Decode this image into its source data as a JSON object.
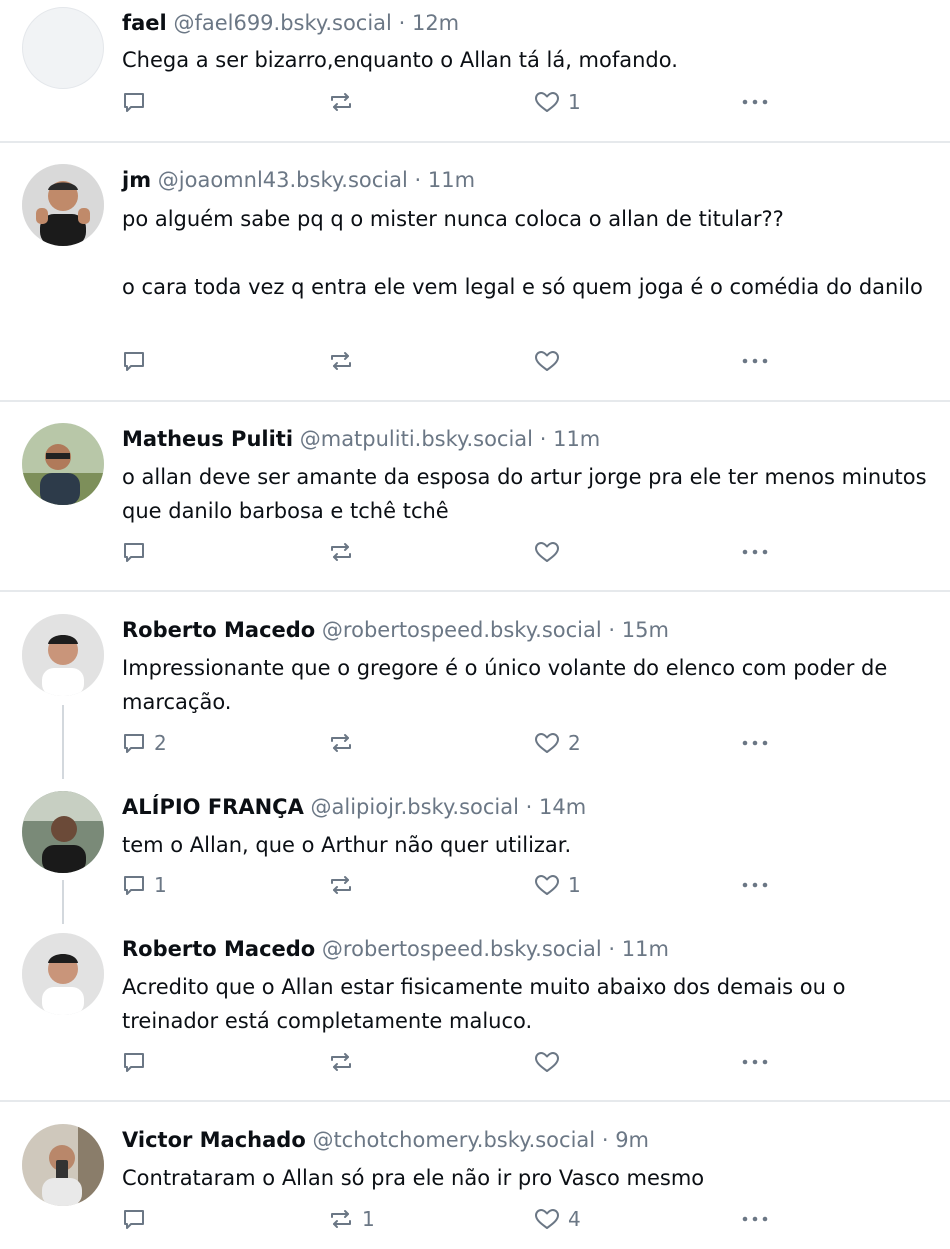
{
  "posts": [
    {
      "name": "fael",
      "handle": "@fael699.bsky.social",
      "sep": "·",
      "time": "12m",
      "text": "Chega a ser bizarro,enquanto o Allan tá lá, mofando.",
      "reply_count": "",
      "repost_count": "",
      "like_count": "1"
    },
    {
      "name": "jm",
      "handle": "@joaomnl43.bsky.social",
      "sep": "·",
      "time": "11m",
      "text": "po alguém sabe pq q o mister nunca coloca o allan de titular??\n\no cara toda vez q entra ele vem legal e só quem joga é o comédia do danilo",
      "reply_count": "",
      "repost_count": "",
      "like_count": ""
    },
    {
      "name": "Matheus Puliti",
      "handle": "@matpuliti.bsky.social",
      "sep": "·",
      "time": "11m",
      "text": "o allan deve ser amante da esposa do artur jorge pra ele ter menos minutos que danilo barbosa e tchê tchê",
      "reply_count": "",
      "repost_count": "",
      "like_count": ""
    },
    {
      "name": "Roberto Macedo",
      "handle": "@robertospeed.bsky.social",
      "sep": "·",
      "time": "15m",
      "text": "Impressionante que o gregore é o único volante do elenco com poder de marcação.",
      "reply_count": "2",
      "repost_count": "",
      "like_count": "2"
    },
    {
      "name": "ALÍPIO FRANÇA",
      "handle": "@alipiojr.bsky.social",
      "sep": "·",
      "time": "14m",
      "text": "tem o Allan, que o Arthur não quer utilizar.",
      "reply_count": "1",
      "repost_count": "",
      "like_count": "1"
    },
    {
      "name": "Roberto Macedo",
      "handle": "@robertospeed.bsky.social",
      "sep": "·",
      "time": "11m",
      "text": "Acredito que o Allan estar fisicamente muito abaixo dos demais ou o treinador está completamente maluco.",
      "reply_count": "",
      "repost_count": "",
      "like_count": ""
    },
    {
      "name": "Victor Machado",
      "handle": "@tchotchomery.bsky.social",
      "sep": "·",
      "time": "9m",
      "text": "Contrataram o Allan só pra ele não ir pro Vasco mesmo",
      "reply_count": "",
      "repost_count": "1",
      "like_count": "4"
    }
  ],
  "icons": {
    "reply": "speech-bubble-icon",
    "repost": "repost-arrows-icon",
    "like": "heart-icon",
    "more": "ellipsis-icon"
  },
  "colors": {
    "text": "#0b0f14",
    "muted": "#6b7785",
    "divider": "#e6e9ec"
  }
}
